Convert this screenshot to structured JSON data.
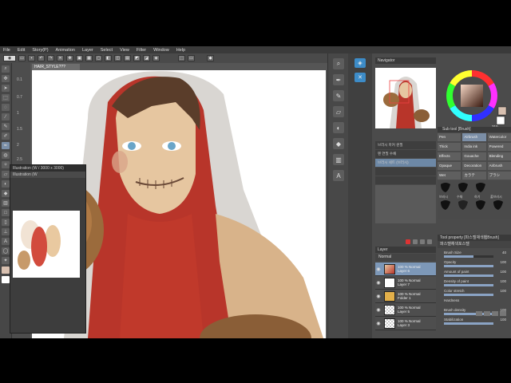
{
  "menu": [
    "File",
    "Edit",
    "Story(P)",
    "Animation",
    "Layer",
    "Select",
    "View",
    "Filter",
    "Window",
    "Help"
  ],
  "canvas_tab": "HAIR_STYLE???",
  "ruler_marks": [
    "0.1",
    "0.7",
    "1",
    "1.5",
    "2",
    "2.5",
    "3",
    "4"
  ],
  "subwin": {
    "title": "Illustration (W / 3000 x 3000)",
    "subtitle": "Illustration (W"
  },
  "navigator_head": "Navigator",
  "subtool_head": "Sub tool [Brush]",
  "brushes": [
    [
      "Pen",
      "Airbrush",
      "Watercolor"
    ],
    [
      "Thick",
      "India ink",
      "Powered"
    ],
    [
      "Effects",
      "Gouache",
      "Blending"
    ],
    [
      "Opaque",
      "Decoration",
      "Airbrush"
    ],
    [
      "Wet",
      "カラテ",
      "ブラシ"
    ]
  ],
  "misc_list": [
    "브러시  마커  원필",
    "펜  연필  수채",
    "브러시 세트 (브러시)",
    "",
    ""
  ],
  "tip_labels": [
    "브러시",
    "수채",
    "하기",
    "풀브러시"
  ],
  "tool_head": "Tool property [파스텔채색봼Brush]",
  "tool_pre": "파스텔채색포스텔",
  "layer_head": "Layer",
  "layer_mode": "Normal",
  "layers": [
    {
      "line1": "100 % Normal",
      "line2": "Layer 6",
      "selected": true,
      "thumb": "art"
    },
    {
      "line1": "100 % Normal",
      "line2": "Layer 7",
      "selected": false,
      "thumb": "white"
    },
    {
      "line1": "100 % Normal",
      "line2": "Folder 1",
      "selected": false,
      "thumb": "folder"
    },
    {
      "line1": "100 % Normal",
      "line2": "Layer 5",
      "selected": false,
      "thumb": "checker"
    },
    {
      "line1": "100 % Normal",
      "line2": "Layer 3",
      "selected": false,
      "thumb": "checker"
    }
  ],
  "props": [
    {
      "label": "Brush Size",
      "value": "40",
      "pct": 0.6
    },
    {
      "label": "Opacity",
      "value": "100",
      "pct": 1.0
    },
    {
      "label": "Amount of paint",
      "value": "100",
      "pct": 1.0
    },
    {
      "label": "Density of paint",
      "value": "100",
      "pct": 1.0
    },
    {
      "label": "Color stretch",
      "value": "100",
      "pct": 1.0
    },
    {
      "label": "Hardness",
      "value": "",
      "pct": 0.0
    },
    {
      "label": "Brush density",
      "value": "100",
      "pct": 1.0
    },
    {
      "label": "Stabilization",
      "value": "100",
      "pct": 1.0
    }
  ],
  "colors": {
    "accent": "#7b8ea6",
    "main_color": "#d8c0b0"
  },
  "wheel_value": "310"
}
